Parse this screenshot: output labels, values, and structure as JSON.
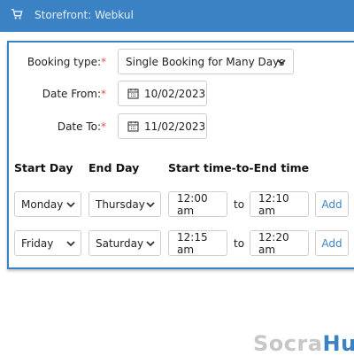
{
  "topbar": {
    "title": "Storefront: Webkul",
    "icon": "cart-icon",
    "color": "#3b82c4"
  },
  "form": {
    "booking_type": {
      "label": "Booking type:",
      "required": "*",
      "value": "Single Booking for Many Days"
    },
    "date_from": {
      "label": "Date From:",
      "required": "*",
      "value": "10/02/2023"
    },
    "date_to": {
      "label": "Date To:",
      "required": "*",
      "value": "11/02/2023"
    }
  },
  "slots": {
    "headers": {
      "start_day": "Start Day",
      "end_day": "End Day",
      "time": "Start time-to-End time"
    },
    "rows": [
      {
        "start_day": "Monday",
        "end_day": "Thursday",
        "start_time": "12:00 am",
        "to": "to",
        "end_time": "12:10 am",
        "add": "Add"
      },
      {
        "start_day": "Friday",
        "end_day": "Saturday",
        "start_time": "12:15 am",
        "to": "to",
        "end_time": "12:20 am",
        "add": "Add"
      }
    ]
  },
  "watermark": {
    "part1": "Socra",
    "part2": "Hub"
  }
}
